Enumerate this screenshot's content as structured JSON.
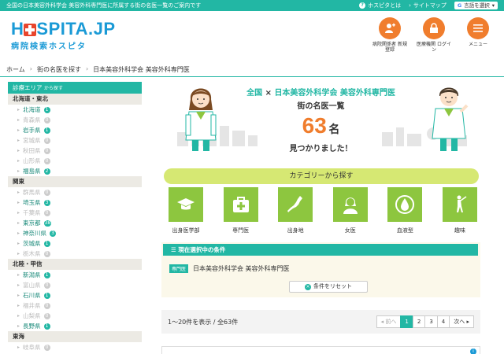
{
  "topbar": {
    "tagline": "全国の日本美容外科学会 美容外科専門医に所属する街の名医一覧のご案内です",
    "about": "ホスピタとは",
    "sitemap": "サイトマップ",
    "lang": "言語を選択"
  },
  "header": {
    "logo_main": "H SPITA.JP",
    "logo_prefix": "H",
    "logo_suffix": "SPITA.JP",
    "logo_sub": "病院検索ホスピタ",
    "buttons": [
      {
        "label": "病院関係者 新規登録",
        "icon": "add-user-icon"
      },
      {
        "label": "医療機関 ログイン",
        "icon": "lock-icon"
      },
      {
        "label": "メニュー",
        "icon": "menu-icon"
      }
    ]
  },
  "breadcrumb": {
    "home": "ホーム",
    "find": "街の名医を探す",
    "current": "日本美容外科学会 美容外科専門医"
  },
  "sidebar": {
    "title": "診療エリア",
    "title_suffix": "から探す",
    "regions": [
      {
        "name": "北海道・東北",
        "prefs": [
          {
            "name": "北海道",
            "count": "1",
            "active": true
          },
          {
            "name": "青森県",
            "count": "0",
            "active": false
          },
          {
            "name": "岩手県",
            "count": "1",
            "active": true
          },
          {
            "name": "宮城県",
            "count": "0",
            "active": false
          },
          {
            "name": "秋田県",
            "count": "0",
            "active": false
          },
          {
            "name": "山形県",
            "count": "0",
            "active": false
          },
          {
            "name": "福島県",
            "count": "2",
            "active": true
          }
        ]
      },
      {
        "name": "関東",
        "prefs": [
          {
            "name": "群馬県",
            "count": "0",
            "active": false
          },
          {
            "name": "埼玉県",
            "count": "3",
            "active": true
          },
          {
            "name": "千葉県",
            "count": "0",
            "active": false
          },
          {
            "name": "東京都",
            "count": "38",
            "active": true
          },
          {
            "name": "神奈川県",
            "count": "3",
            "active": true
          },
          {
            "name": "茨城県",
            "count": "1",
            "active": true
          },
          {
            "name": "栃木県",
            "count": "0",
            "active": false
          }
        ]
      },
      {
        "name": "北陸・甲信",
        "prefs": [
          {
            "name": "新潟県",
            "count": "1",
            "active": true
          },
          {
            "name": "富山県",
            "count": "0",
            "active": false
          },
          {
            "name": "石川県",
            "count": "1",
            "active": true
          },
          {
            "name": "福井県",
            "count": "0",
            "active": false
          },
          {
            "name": "山梨県",
            "count": "0",
            "active": false
          },
          {
            "name": "長野県",
            "count": "1",
            "active": true
          }
        ]
      },
      {
        "name": "東海",
        "prefs": [
          {
            "name": "岐阜県",
            "count": "0",
            "active": false
          }
        ]
      }
    ]
  },
  "hero": {
    "scope": "全国",
    "cross": "×",
    "society": "日本美容外科学会 美容外科専門医",
    "subtitle": "街の名医一覧",
    "count": "63",
    "unit": "名",
    "found": "見つかりました！"
  },
  "categories": {
    "title": "カテゴリーから探す",
    "items": [
      {
        "label": "出身医学部",
        "icon": "graduation-cap-icon"
      },
      {
        "label": "専門医",
        "icon": "medical-kit-icon"
      },
      {
        "label": "出身地",
        "icon": "japan-map-icon"
      },
      {
        "label": "女医",
        "icon": "female-doctor-icon"
      },
      {
        "label": "血液型",
        "icon": "blood-drop-icon"
      },
      {
        "label": "趣味",
        "icon": "golf-icon"
      }
    ]
  },
  "selection": {
    "title": "現在選択中の条件",
    "tag": "専門医",
    "value": "日本美容外科学会 美容外科専門医",
    "reset": "条件をリセット"
  },
  "pagination": {
    "info": "1〜20件を表示 / 全63件",
    "prev": "前へ",
    "pages": [
      "1",
      "2",
      "3",
      "4"
    ],
    "current": "1",
    "next": "次へ"
  },
  "colors": {
    "accent": "#22b7a4",
    "logo_blue": "#1a9ad6",
    "orange": "#f07d2d",
    "green_tile": "#8dc63f"
  }
}
